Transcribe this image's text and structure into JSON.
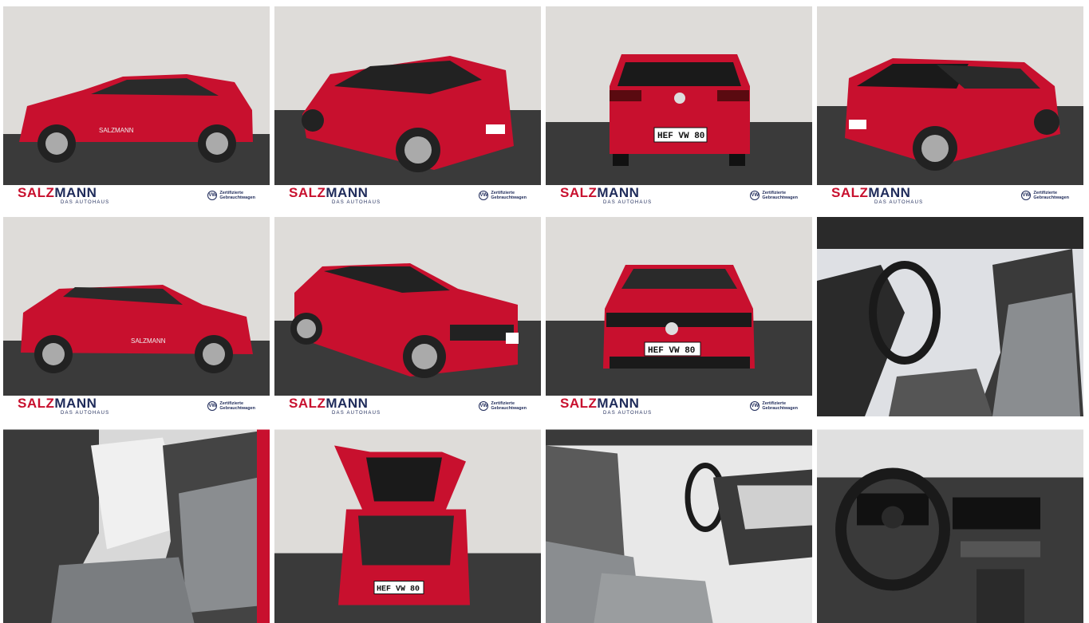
{
  "gallery": {
    "brand_red": "SALZ",
    "brand_navy": "MANN",
    "brand_sub": "DAS AUTOHAUS",
    "vw_line1": "Zertifizierte",
    "vw_line2": "Gebrauchtwagen",
    "plate": "HEF VW 80",
    "door_text": "SALZMANN"
  },
  "colors": {
    "car_red": "#c8102e",
    "brand_navy": "#1f2b5a"
  },
  "tiles": [
    {
      "id": "side-left"
    },
    {
      "id": "rear-left-34"
    },
    {
      "id": "rear"
    },
    {
      "id": "rear-right-34"
    },
    {
      "id": "side-right"
    },
    {
      "id": "front-right-34"
    },
    {
      "id": "front"
    },
    {
      "id": "interior-front-seats"
    },
    {
      "id": "interior-rear-seats"
    },
    {
      "id": "trunk-open"
    },
    {
      "id": "interior-dash-passenger"
    },
    {
      "id": "interior-cockpit"
    }
  ]
}
